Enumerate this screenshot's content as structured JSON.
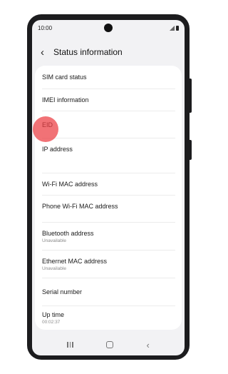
{
  "status_bar": {
    "time": "10:00"
  },
  "header": {
    "title": "Status information"
  },
  "items": [
    {
      "label": "SIM card status"
    },
    {
      "label": "IMEI information"
    },
    {
      "label": "EID"
    },
    {
      "label": "IP address"
    },
    {
      "label": "Wi-Fi MAC address"
    },
    {
      "label": "Phone Wi-Fi MAC address"
    },
    {
      "label": "Bluetooth address",
      "sub": "Unavailable"
    },
    {
      "label": "Ethernet MAC address",
      "sub": "Unavailable"
    },
    {
      "label": "Serial number"
    },
    {
      "label": "Up time",
      "sub": "00:02:37"
    }
  ],
  "icons": {
    "back": "chevron-left-icon",
    "nav_recent": "recent-apps-icon",
    "nav_home": "home-icon",
    "nav_back": "back-arrow-icon"
  },
  "colors": {
    "touch_indicator": "#eb3c41",
    "background": "#f2f2f4",
    "card": "#ffffff"
  }
}
